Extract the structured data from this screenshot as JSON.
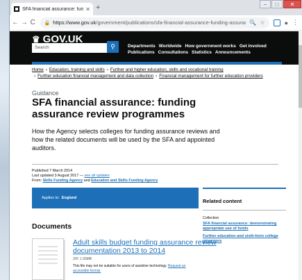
{
  "browser": {
    "tab_title": "SFA financial assurance: funding",
    "url_host": "https://www.gov.uk",
    "url_path": "/government/publications/sfa-financial-assurance-funding-assurance-..."
  },
  "header": {
    "logo": "GOV.UK",
    "search_placeholder": "Search",
    "nav_row1": [
      "Departments",
      "Worldwide",
      "How government works",
      "Get involved"
    ],
    "nav_row2": [
      "Publications",
      "Consultations",
      "Statistics",
      "Announcements"
    ]
  },
  "breadcrumbs": {
    "row1": [
      "Home",
      "Education, training and skills",
      "Further and higher education, skills and vocational training"
    ],
    "row2": [
      "Further education financial management and data collection",
      "Financial management for further education providers"
    ]
  },
  "page": {
    "caption": "Guidance",
    "title": "SFA financial assurance: funding assurance review programmes",
    "lede": "How the Agency selects colleges for funding assurance reviews and how the related documents will be used by the SFA and appointed auditors.",
    "published": "Published 7 March 2014",
    "updated": "Last updated 3 August 2017",
    "updated_sep": " — ",
    "see_all": "see all updates",
    "from_label": "From: ",
    "from_org1": "Skills Funding Agency",
    "from_and": " and ",
    "from_org2": "Education and Skills Funding Agency"
  },
  "applies": {
    "label": "Applies to:",
    "value": "England"
  },
  "related": {
    "heading": "Related content",
    "collection_label": "Collection",
    "link1": "SFA financial assurance: demonstrating appropriate use of funds",
    "link2": "Further education and sixth-form college governors"
  },
  "documents": {
    "heading": "Documents",
    "title": "Adult skills budget funding assurance review documentation 2013 to 2014",
    "meta": "ZIP, 1.59MB",
    "note": "This file may not be suitable for users of assistive technology. ",
    "note_link": "Request an accessible format."
  }
}
